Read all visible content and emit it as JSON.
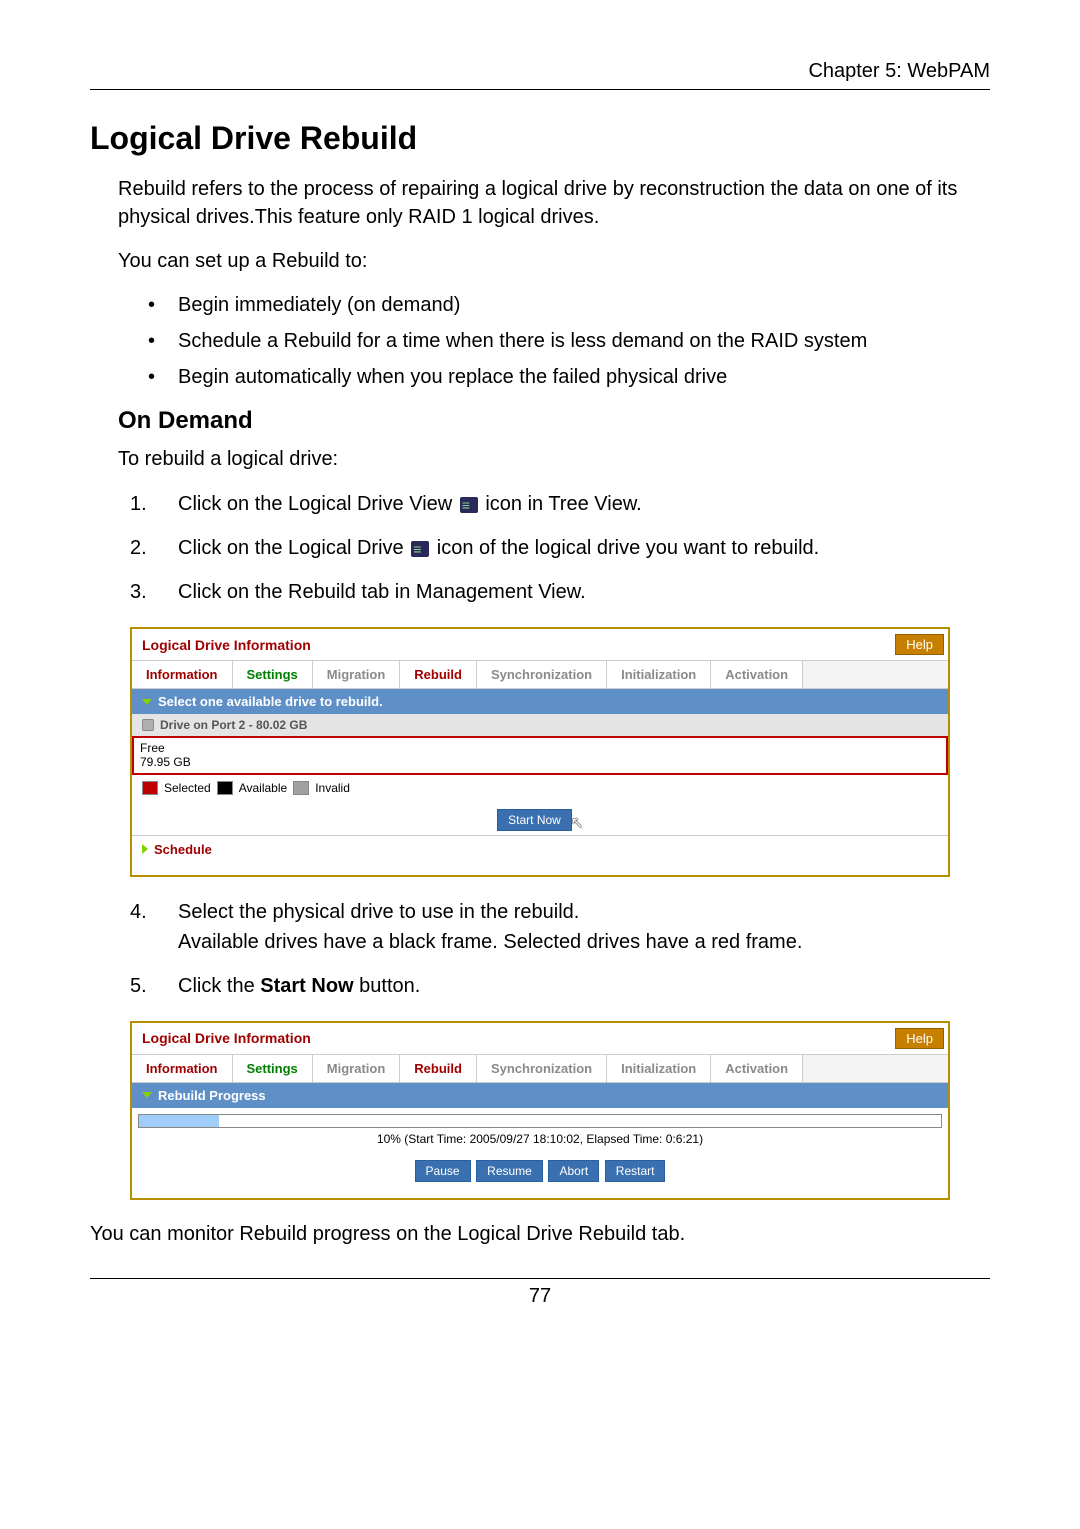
{
  "header": {
    "chapter": "Chapter 5: WebPAM"
  },
  "title": "Logical Drive Rebuild",
  "intro": "Rebuild refers to the process of repairing a logical drive by reconstruction the data on one of its physical drives.This feature only RAID 1 logical drives.",
  "setup_lead": "You can set up a Rebuild to:",
  "bullets": [
    "Begin immediately (on demand)",
    "Schedule a Rebuild for a time when there is less demand on the RAID system",
    "Begin automatically when you replace the failed physical drive"
  ],
  "ondemand": {
    "heading": "On Demand",
    "lead": "To rebuild a logical drive:",
    "steps_before": [
      {
        "pre": "Click on the Logical Drive View ",
        "post": " icon in Tree View."
      },
      {
        "pre": "Click on the Logical Drive ",
        "post": " icon of the logical drive you want to rebuild."
      },
      {
        "pre": "Click on the Rebuild tab in Management View.",
        "post": ""
      }
    ]
  },
  "panel1": {
    "title": "Logical Drive Information",
    "help": "Help",
    "tabs": {
      "information": "Information",
      "settings": "Settings",
      "migration": "Migration",
      "rebuild": "Rebuild",
      "synchronization": "Synchronization",
      "initialization": "Initialization",
      "activation": "Activation"
    },
    "select_text": "Select one available drive to rebuild.",
    "drive_label": "Drive on Port 2 - 80.02 GB",
    "free_line1": "Free",
    "free_line2": "79.95 GB",
    "legend": {
      "selected": "Selected",
      "available": "Available",
      "invalid": "Invalid"
    },
    "start_now": "Start Now",
    "schedule": "Schedule"
  },
  "steps_after": {
    "step4a": "Select the physical drive to use in the rebuild.",
    "step4b": "Available drives have a black frame. Selected drives have a red frame.",
    "step5_pre": "Click the ",
    "step5_strong": "Start Now",
    "step5_post": " button."
  },
  "panel2": {
    "title": "Logical Drive Information",
    "help": "Help",
    "section": "Rebuild Progress",
    "progress_pct": 10,
    "progress_text": "10% (Start Time: 2005/09/27 18:10:02, Elapsed Time: 0:6:21)",
    "buttons": {
      "pause": "Pause",
      "resume": "Resume",
      "abort": "Abort",
      "restart": "Restart"
    }
  },
  "closing": "You can monitor Rebuild progress on the Logical Drive Rebuild tab.",
  "page_number": "77"
}
